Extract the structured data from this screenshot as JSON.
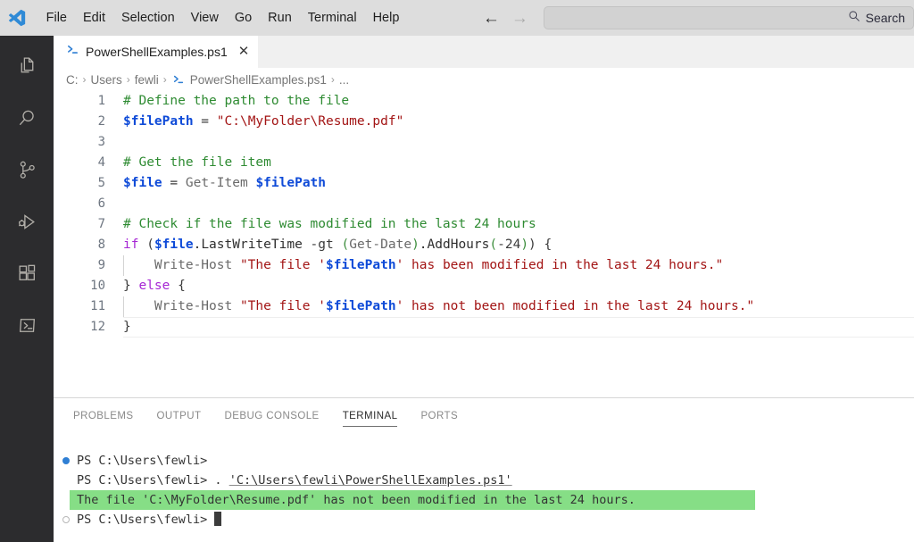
{
  "titlebar": {
    "logo_icon": "vscode-logo-icon",
    "menus": [
      "File",
      "Edit",
      "Selection",
      "View",
      "Go",
      "Run",
      "Terminal",
      "Help"
    ],
    "nav": {
      "back_icon": "arrow-left-icon",
      "back_glyph": "←",
      "forward_icon": "arrow-right-icon",
      "forward_glyph": "→"
    },
    "search": {
      "icon": "search-icon",
      "label": "Search",
      "value": "",
      "placeholder": ""
    }
  },
  "activitybar": {
    "items": [
      {
        "name": "explorer",
        "icon": "files-icon"
      },
      {
        "name": "search",
        "icon": "search-icon"
      },
      {
        "name": "source-control",
        "icon": "source-control-icon"
      },
      {
        "name": "run-and-debug",
        "icon": "run-debug-icon"
      },
      {
        "name": "extensions",
        "icon": "extensions-icon"
      },
      {
        "name": "powershell",
        "icon": "terminal-console-icon"
      }
    ]
  },
  "tab": {
    "icon": "powershell-file-icon",
    "label": "PowerShellExamples.ps1",
    "close_icon": "close-icon",
    "close_glyph": "✕"
  },
  "breadcrumbs": {
    "separator": "›",
    "items": [
      "C:",
      "Users",
      "fewli",
      "PowerShellExamples.ps1",
      "..."
    ],
    "file_icon": "powershell-file-icon"
  },
  "editor": {
    "language": "powershell",
    "lines": [
      {
        "n": "1",
        "tokens": [
          {
            "c": "t-comment",
            "t": "# Define the path to the file"
          }
        ]
      },
      {
        "n": "2",
        "tokens": [
          {
            "c": "t-var",
            "t": "$filePath"
          },
          {
            "c": "t-op",
            "t": " = "
          },
          {
            "c": "t-string",
            "t": "\"C:\\MyFolder\\Resume.pdf\""
          }
        ]
      },
      {
        "n": "3",
        "tokens": []
      },
      {
        "n": "4",
        "tokens": [
          {
            "c": "t-comment",
            "t": "# Get the file item"
          }
        ]
      },
      {
        "n": "5",
        "tokens": [
          {
            "c": "t-var",
            "t": "$file"
          },
          {
            "c": "t-op",
            "t": " = "
          },
          {
            "c": "t-cmdlet",
            "t": "Get-Item "
          },
          {
            "c": "t-var",
            "t": "$filePath"
          }
        ]
      },
      {
        "n": "6",
        "tokens": []
      },
      {
        "n": "7",
        "tokens": [
          {
            "c": "t-comment",
            "t": "# Check if the file was modified in the last 24 hours"
          }
        ]
      },
      {
        "n": "8",
        "tokens": [
          {
            "c": "t-kw",
            "t": "if"
          },
          {
            "c": "t-plain",
            "t": " ("
          },
          {
            "c": "t-var",
            "t": "$file"
          },
          {
            "c": "t-prop",
            "t": ".LastWriteTime "
          },
          {
            "c": "t-op",
            "t": "-gt"
          },
          {
            "c": "t-plain",
            "t": " "
          },
          {
            "c": "t-paren",
            "t": "("
          },
          {
            "c": "t-cmdlet",
            "t": "Get-Date"
          },
          {
            "c": "t-paren",
            "t": ")"
          },
          {
            "c": "t-prop",
            "t": ".AddHours"
          },
          {
            "c": "t-paren",
            "t": "("
          },
          {
            "c": "t-num",
            "t": "-24"
          },
          {
            "c": "t-paren",
            "t": ")"
          },
          {
            "c": "t-plain",
            "t": ") {"
          }
        ]
      },
      {
        "n": "9",
        "indent": true,
        "tokens": [
          {
            "c": "t-plain",
            "t": "    "
          },
          {
            "c": "t-cmdlet",
            "t": "Write-Host "
          },
          {
            "c": "t-string",
            "t": "\"The file '"
          },
          {
            "c": "t-var",
            "t": "$filePath"
          },
          {
            "c": "t-string",
            "t": "' has been modified in the last 24 hours.\""
          }
        ]
      },
      {
        "n": "10",
        "tokens": [
          {
            "c": "t-plain",
            "t": "} "
          },
          {
            "c": "t-kw",
            "t": "else"
          },
          {
            "c": "t-plain",
            "t": " {"
          }
        ]
      },
      {
        "n": "11",
        "indent": true,
        "tokens": [
          {
            "c": "t-plain",
            "t": "    "
          },
          {
            "c": "t-cmdlet",
            "t": "Write-Host "
          },
          {
            "c": "t-string",
            "t": "\"The file '"
          },
          {
            "c": "t-var",
            "t": "$filePath"
          },
          {
            "c": "t-string",
            "t": "' has not been modified in the last 24 hours.\""
          }
        ]
      },
      {
        "n": "12",
        "current": true,
        "tokens": [
          {
            "c": "t-plain",
            "t": "}"
          }
        ]
      }
    ]
  },
  "panel": {
    "tabs": [
      {
        "label": "PROBLEMS",
        "active": false
      },
      {
        "label": "OUTPUT",
        "active": false
      },
      {
        "label": "DEBUG CONSOLE",
        "active": false
      },
      {
        "label": "TERMINAL",
        "active": true
      },
      {
        "label": "PORTS",
        "active": false
      }
    ],
    "terminal": {
      "highlight_color": "#86de86",
      "lines": [
        {
          "marker": "filled",
          "segments": [
            {
              "t": "PS C:\\Users\\fewli>",
              "link": false
            }
          ],
          "highlight": false
        },
        {
          "marker": "none",
          "segments": [
            {
              "t": "PS C:\\Users\\fewli> . ",
              "link": false
            },
            {
              "t": "'C:\\Users\\fewli\\PowerShellExamples.ps1'",
              "link": true
            }
          ],
          "highlight": false
        },
        {
          "marker": "none",
          "segments": [
            {
              "t": "The file 'C:\\MyFolder\\Resume.pdf' has not been modified in the last 24 hours.",
              "link": false
            }
          ],
          "highlight": true,
          "highlight_width": 768
        },
        {
          "marker": "hollow",
          "segments": [
            {
              "t": "PS C:\\Users\\fewli> ",
              "link": false
            }
          ],
          "highlight": false,
          "cursor": true
        }
      ]
    }
  },
  "colors": {
    "titlebar_bg": "#dddddd",
    "activitybar_bg": "#2c2c2e",
    "editor_bg": "#ffffff",
    "tab_active_bg": "#ffffff",
    "tabbar_bg": "#f0f0f0",
    "accent_blue": "#0f4bd8",
    "comment_green": "#2e8b32",
    "string_red": "#a31515",
    "keyword_purple": "#a626d4",
    "terminal_highlight": "#86de86"
  }
}
